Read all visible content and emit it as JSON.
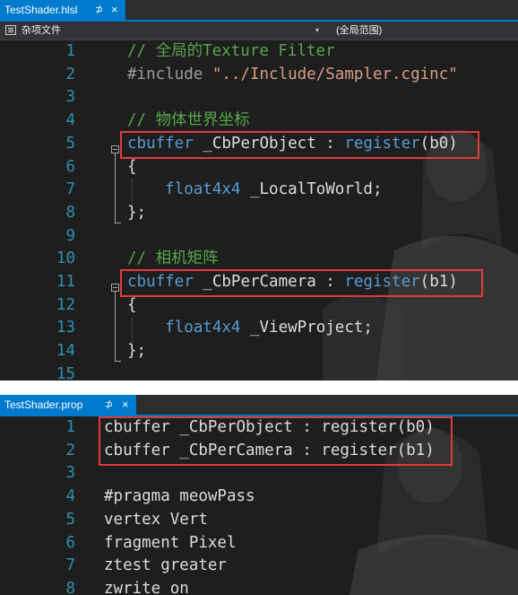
{
  "editor1": {
    "tab": {
      "title": "TestShader.hlsl",
      "pin": "⊅",
      "close": "×"
    },
    "nav": {
      "project": "杂项文件",
      "dropdown_arrow": "▾",
      "scope": "(全局范围)"
    },
    "lines": [
      {
        "n": "1",
        "parts": [
          [
            "// 全局的Texture Filter",
            "cm"
          ]
        ]
      },
      {
        "n": "2",
        "parts": [
          [
            "#include ",
            "pp"
          ],
          [
            "\"../Include/Sampler.cginc\"",
            "st"
          ]
        ]
      },
      {
        "n": "3",
        "parts": []
      },
      {
        "n": "4",
        "parts": [
          [
            "// 物体世界坐标",
            "cm"
          ]
        ]
      },
      {
        "n": "5",
        "parts": [
          [
            "cbuffer",
            "kw"
          ],
          [
            " _CbPerObject ",
            "id"
          ],
          [
            ": ",
            "id"
          ],
          [
            "register",
            "kw"
          ],
          [
            "(b0)",
            "id"
          ]
        ]
      },
      {
        "n": "6",
        "parts": [
          [
            "{",
            "id"
          ]
        ]
      },
      {
        "n": "7",
        "parts": [
          [
            "    ",
            "id"
          ],
          [
            "float4x4",
            "kw"
          ],
          [
            " _LocalToWorld;",
            "id"
          ]
        ]
      },
      {
        "n": "8",
        "parts": [
          [
            "};",
            "id"
          ]
        ]
      },
      {
        "n": "9",
        "parts": []
      },
      {
        "n": "10",
        "parts": [
          [
            "// 相机矩阵",
            "cm"
          ]
        ]
      },
      {
        "n": "11",
        "parts": [
          [
            "cbuffer",
            "kw"
          ],
          [
            " _CbPerCamera ",
            "id"
          ],
          [
            ": ",
            "id"
          ],
          [
            "register",
            "kw"
          ],
          [
            "(b1)",
            "id"
          ]
        ]
      },
      {
        "n": "12",
        "parts": [
          [
            "{",
            "id"
          ]
        ]
      },
      {
        "n": "13",
        "parts": [
          [
            "    ",
            "id"
          ],
          [
            "float4x4",
            "kw"
          ],
          [
            " _ViewProject;",
            "id"
          ]
        ]
      },
      {
        "n": "14",
        "parts": [
          [
            "};",
            "id"
          ]
        ]
      },
      {
        "n": "15",
        "parts": []
      }
    ]
  },
  "editor2": {
    "tab": {
      "title": "TestShader.prop",
      "pin": "⊅",
      "close": "×"
    },
    "lines": [
      {
        "n": "1",
        "parts": [
          [
            "cbuffer _CbPerObject : register(b0)",
            "id"
          ]
        ]
      },
      {
        "n": "2",
        "parts": [
          [
            "cbuffer _CbPerCamera : register(b1)",
            "id"
          ]
        ]
      },
      {
        "n": "3",
        "parts": []
      },
      {
        "n": "4",
        "parts": [
          [
            "#pragma meowPass",
            "id"
          ]
        ]
      },
      {
        "n": "5",
        "parts": [
          [
            "vertex Vert",
            "id"
          ]
        ]
      },
      {
        "n": "6",
        "parts": [
          [
            "fragment Pixel",
            "id"
          ]
        ]
      },
      {
        "n": "7",
        "parts": [
          [
            "ztest greater",
            "id"
          ]
        ]
      },
      {
        "n": "8",
        "parts": [
          [
            "zwrite on",
            "id"
          ]
        ]
      }
    ]
  },
  "colors": {
    "accent": "#007acc",
    "highlight_box": "#e03b3b",
    "line_number": "#2b91af",
    "keyword": "#569cd6",
    "comment": "#57a64a",
    "string": "#d69d85"
  }
}
